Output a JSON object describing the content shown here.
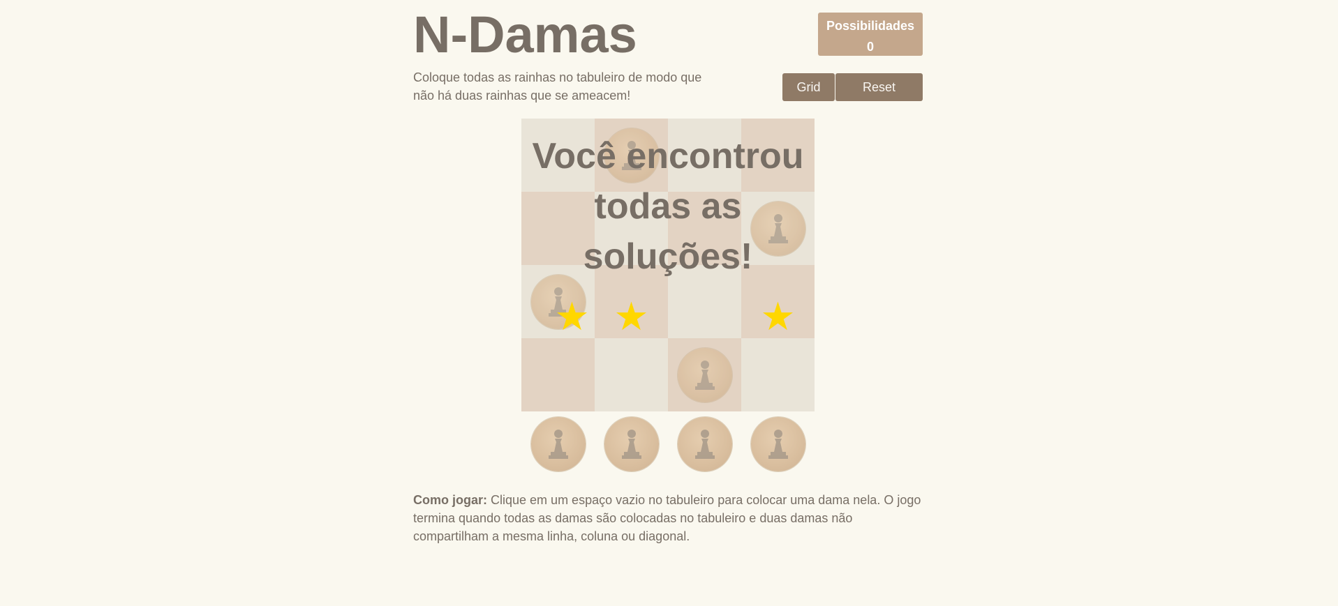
{
  "header": {
    "title": "N-Damas",
    "intro": "Coloque todas as rainhas no tabuleiro de modo que não há duas rainhas que se ameacem!"
  },
  "score": {
    "label": "Possibilidades",
    "value": "0"
  },
  "buttons": {
    "grid_label": "Grid",
    "reset_label": "Reset"
  },
  "board": {
    "size": 4,
    "queens": [
      {
        "row": 0,
        "col": 1
      },
      {
        "row": 1,
        "col": 3
      },
      {
        "row": 2,
        "col": 0
      },
      {
        "row": 3,
        "col": 2
      }
    ],
    "stars": [
      {
        "row": 2,
        "col": 0
      },
      {
        "row": 2,
        "col": 1
      },
      {
        "row": 2,
        "col": 3
      }
    ],
    "overlay_message": "Você encontrou todas as soluções!",
    "light_color": "#e9e4d8",
    "dark_color": "#e3d3c3"
  },
  "tray": {
    "count": 4
  },
  "howto": {
    "label": "Como jogar:",
    "text": "Clique em um espaço vazio no tabuleiro para colocar uma dama nela. O jogo termina quando todas as damas são colocadas no tabuleiro e duas damas não compartilham a mesma linha, coluna ou diagonal."
  },
  "colors": {
    "background": "#faf8ef",
    "text": "#776e65",
    "button": "#8f7a66",
    "score_box": "#c4a78c",
    "star": "#ffd700"
  },
  "icons": {
    "queen": "chess-piece-icon",
    "star": "star-icon"
  }
}
